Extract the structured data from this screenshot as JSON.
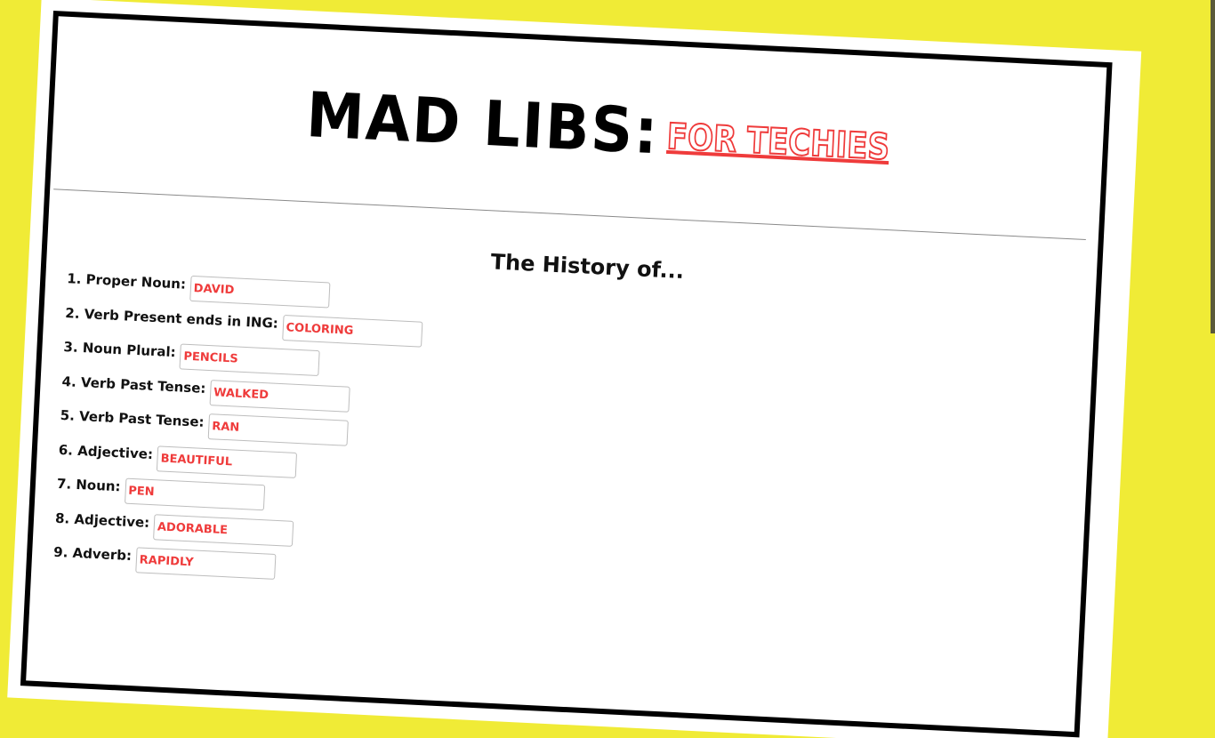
{
  "header": {
    "title": "MAD LIBS:",
    "subtitle": "FOR TECHIES"
  },
  "story": {
    "title": "The History of..."
  },
  "fields": [
    {
      "label": "1. Proper Noun:",
      "value": "DAVID"
    },
    {
      "label": "2. Verb Present ends in ING:",
      "value": "COLORING"
    },
    {
      "label": "3. Noun Plural:",
      "value": "PENCILS"
    },
    {
      "label": "4. Verb Past Tense:",
      "value": "WALKED"
    },
    {
      "label": "5. Verb Past Tense:",
      "value": "RAN"
    },
    {
      "label": "6. Adjective:",
      "value": "BEAUTIFUL"
    },
    {
      "label": "7. Noun:",
      "value": "PEN"
    },
    {
      "label": "8. Adjective:",
      "value": "ADORABLE"
    },
    {
      "label": "9. Adverb:",
      "value": "RAPIDLY"
    }
  ],
  "colors": {
    "background": "#f0eb36",
    "accent": "#ef3b3b",
    "frame": "#000000"
  }
}
